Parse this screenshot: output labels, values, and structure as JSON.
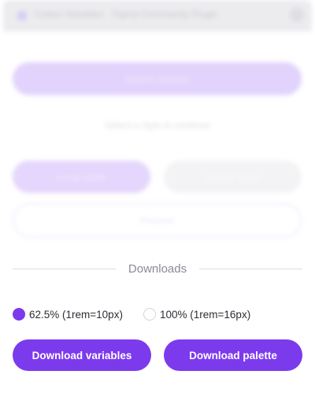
{
  "header": {
    "title": "Colour Variables · Figma Community Plugin"
  },
  "background": {
    "primary_button": "Select colours",
    "note": "Select a style to continue",
    "option_a": "Local styles",
    "option_b": "Library styles",
    "outline_button": "Preview"
  },
  "downloads": {
    "title": "Downloads",
    "unit_options": [
      {
        "label": "62.5% (1rem=10px)",
        "selected": true
      },
      {
        "label": "100% (1rem=16px)",
        "selected": false
      }
    ],
    "download_variables_label": "Download variables",
    "download_palette_label": "Download palette"
  },
  "colors": {
    "accent": "#7c3aed"
  }
}
